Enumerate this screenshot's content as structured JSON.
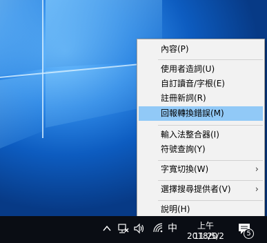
{
  "context_menu": {
    "items": [
      {
        "label": "內容(P)"
      },
      {
        "label": "使用者造詞(U)"
      },
      {
        "label": "自訂讀音/字根(E)"
      },
      {
        "label": "註冊新詞(R)"
      },
      {
        "label": "回報轉換錯誤(M)",
        "highlighted": true
      },
      {
        "label": "輸入法整合器(I)"
      },
      {
        "label": "符號查詢(Y)"
      },
      {
        "label": "字寬切換(W)",
        "submenu": true
      },
      {
        "label": "選擇搜尋提供者(V)",
        "submenu": true
      },
      {
        "label": "說明(H)"
      }
    ],
    "highlight_color": "#91c9f7"
  },
  "taskbar": {
    "tray_icons": [
      "chevron-up-icon",
      "network-disconnected-icon",
      "volume-icon",
      "wifi-icon"
    ],
    "ime_indicator": "中",
    "clock_time": "上午 11:20",
    "clock_date": "2018/5/2",
    "notification_count": "5"
  },
  "colors": {
    "taskbar": "#0a0d14",
    "menu_bg": "#f2f2f2"
  }
}
